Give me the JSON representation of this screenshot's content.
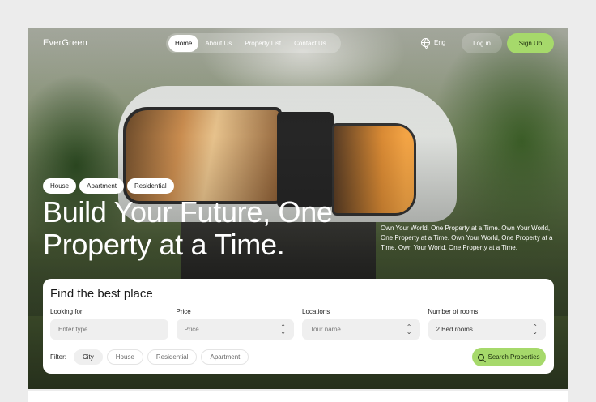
{
  "brand": "EverGreen",
  "nav": {
    "items": [
      "Home",
      "About Us",
      "Property List",
      "Contact Us"
    ],
    "active_index": 0
  },
  "language": "Eng",
  "auth": {
    "login": "Log in",
    "signup": "Sign Up"
  },
  "hero": {
    "tags": [
      "House",
      "Apartment",
      "Residential"
    ],
    "headline": "Build Your Future, One Property at a Time.",
    "subtext": "Own Your World, One Property at a Time. Own Your World, One Property at a Time. Own Your World, One Property at a Time. Own Your World, One Property at a Time."
  },
  "search": {
    "title": "Find the best place",
    "fields": [
      {
        "label": "Looking for",
        "placeholder": "Enter type",
        "value": "",
        "type": "input"
      },
      {
        "label": "Price",
        "value": "Price",
        "type": "select"
      },
      {
        "label": "Locations",
        "value": "Tour name",
        "type": "select"
      },
      {
        "label": "Number of rooms",
        "value": "2 Bed rooms",
        "type": "select"
      }
    ],
    "filter_label": "Filter:",
    "filters": [
      "City",
      "House",
      "Residential",
      "Apartment"
    ],
    "active_filter": 0,
    "button": "Search Properties"
  },
  "colors": {
    "accent": "#a6d96b",
    "card": "#ffffff",
    "field_bg": "#efefef"
  }
}
